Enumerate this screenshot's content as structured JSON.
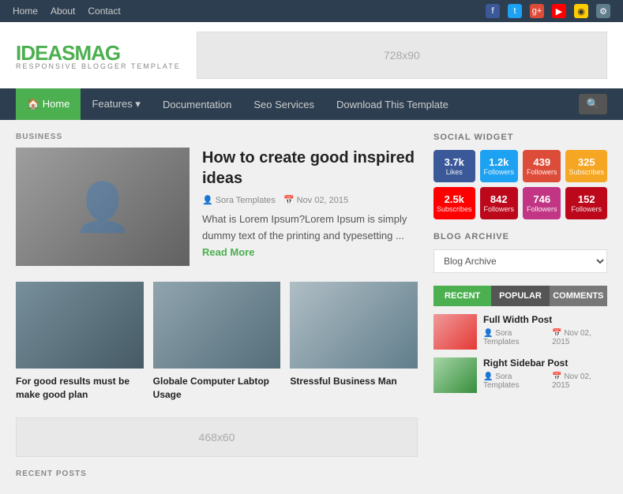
{
  "topnav": {
    "items": [
      {
        "label": "Home",
        "active": true
      },
      {
        "label": "About"
      },
      {
        "label": "Contact"
      }
    ],
    "social_icons": [
      "fb",
      "tw",
      "gp",
      "yt",
      "sc",
      "set"
    ]
  },
  "header": {
    "logo_text": "IDEAS",
    "logo_accent": "MAG",
    "logo_sub": "RESPONSIVE BLOGGER TEMPLATE",
    "ad_size": "728x90"
  },
  "mainnav": {
    "items": [
      {
        "label": "🏠 Home",
        "active": true
      },
      {
        "label": "Features ▾"
      },
      {
        "label": "Documentation"
      },
      {
        "label": "Seo Services"
      },
      {
        "label": "Download This Template"
      }
    ],
    "search_icon": "🔍"
  },
  "main": {
    "section_label": "BUSINESS",
    "featured": {
      "title": "How to create good inspired ideas",
      "author": "Sora Templates",
      "date": "Nov 02, 2015",
      "excerpt": "What is Lorem Ipsum?Lorem Ipsum is simply dummy text of the printing and typesetting ...",
      "read_more": "Read More"
    },
    "grid_posts": [
      {
        "title": "For good results must be make good plan"
      },
      {
        "title": "Globale Computer Labtop Usage"
      },
      {
        "title": "Stressful Business Man"
      }
    ],
    "ad_size2": "468x60",
    "recent_label": "RECENT POSTS"
  },
  "sidebar": {
    "social_widget_label": "SOCIAL WIDGET",
    "social_boxes": [
      {
        "network": "facebook",
        "count": "3.7k",
        "label": "Likes",
        "class": "sb-fb"
      },
      {
        "network": "twitter",
        "count": "1.2k",
        "label": "Followers",
        "class": "sb-tw"
      },
      {
        "network": "googleplus",
        "count": "439",
        "label": "Followers",
        "class": "sb-gp"
      },
      {
        "network": "rss",
        "count": "325",
        "label": "Subscribes",
        "class": "sb-rss"
      },
      {
        "network": "youtube",
        "count": "2.5k",
        "label": "Subscribes",
        "class": "sb-yt"
      },
      {
        "network": "pinterest",
        "count": "842",
        "label": "Followers",
        "class": "sb-pi"
      },
      {
        "network": "instagram",
        "count": "746",
        "label": "Followers",
        "class": "sb-ig"
      },
      {
        "network": "pinterest2",
        "count": "152",
        "label": "Followers",
        "class": "sb-pi2"
      }
    ],
    "blog_archive_label": "BLOG ARCHIVE",
    "blog_archive_placeholder": "Blog Archive",
    "tabs": [
      {
        "label": "RECENT",
        "active": true
      },
      {
        "label": "POPULAR"
      },
      {
        "label": "COMMENTS"
      }
    ],
    "recent_posts": [
      {
        "title": "Full Width Post",
        "author": "Sora Templates",
        "date": "Nov 02, 2015"
      },
      {
        "title": "Right Sidebar Post",
        "author": "Sora Templates",
        "date": "Nov 02, 2015"
      }
    ]
  }
}
